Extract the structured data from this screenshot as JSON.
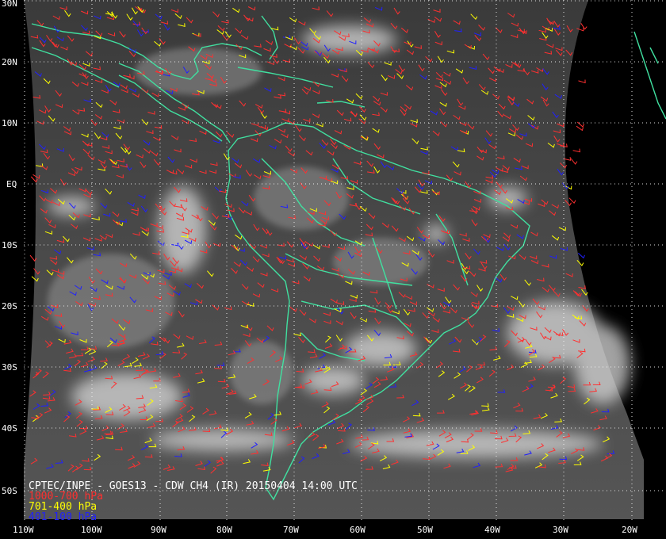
{
  "title": "CPTEC/INPE - GOES13 - CDW CH4 (IR) 20150404 14:00 UTC",
  "legend": [
    {
      "label": "1000-700 hPa",
      "color": "#ff3030"
    },
    {
      "label": "701-400 hPa",
      "color": "#ffff00"
    },
    {
      "label": "401-100 hPa",
      "color": "#2020ff"
    }
  ],
  "lat_labels": [
    "30N",
    "20N",
    "10N",
    "EQ",
    "10S",
    "20S",
    "30S",
    "40S",
    "50S"
  ],
  "lon_labels": [
    "110W",
    "100W",
    "90W",
    "80W",
    "70W",
    "60W",
    "50W",
    "40W",
    "30W",
    "20W"
  ],
  "colors": {
    "background": "#000000",
    "coastline": "#40e0a0",
    "grid": "#ffffff"
  }
}
